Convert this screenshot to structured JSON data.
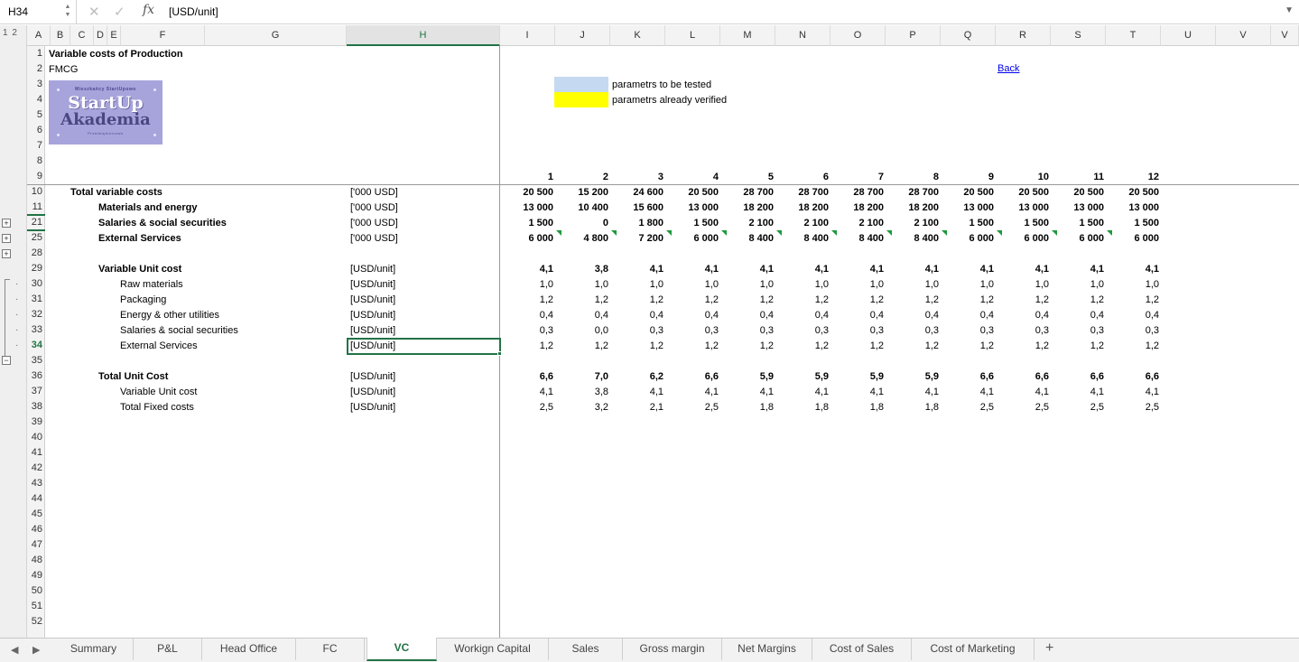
{
  "formula_bar": {
    "name_box": "H34",
    "cancel_icon": "close-icon",
    "confirm_icon": "check-icon",
    "fx_label": "fx",
    "value": "[USD/unit]"
  },
  "outline": {
    "levels": "1 2"
  },
  "columns": [
    "A",
    "B",
    "C",
    "D",
    "E",
    "F",
    "G",
    "H",
    "I",
    "J",
    "K",
    "L",
    "M",
    "N",
    "O",
    "P",
    "Q",
    "R",
    "S",
    "T",
    "U",
    "V",
    "V"
  ],
  "rows": [
    "1",
    "2",
    "3",
    "4",
    "5",
    "6",
    "7",
    "8",
    "9",
    "10",
    "11",
    "21",
    "25",
    "28",
    "29",
    "30",
    "31",
    "32",
    "33",
    "34",
    "35",
    "36",
    "37",
    "38",
    "39",
    "40",
    "41",
    "42",
    "43",
    "44",
    "45",
    "46",
    "47",
    "48",
    "49",
    "50",
    "51",
    "52"
  ],
  "header": {
    "title": "Variable costs of Production",
    "subtitle": "FMCG",
    "back_link": "Back",
    "legend_tested": "parametrs to be tested",
    "legend_verified": "parametrs already verified",
    "logo": {
      "top": "Mieszkańcy StartUpowo",
      "main1": "StartUp",
      "main2": "Akademia",
      "bottom": "Przedsiębiorcowo"
    }
  },
  "months": [
    "1",
    "2",
    "3",
    "4",
    "5",
    "6",
    "7",
    "8",
    "9",
    "10",
    "11",
    "12"
  ],
  "table_rows": [
    {
      "label": "Total variable costs",
      "indent": 0,
      "bold": true,
      "unit": "['000 USD]",
      "values": [
        "20 500",
        "15 200",
        "24 600",
        "20 500",
        "28 700",
        "28 700",
        "28 700",
        "28 700",
        "20 500",
        "20 500",
        "20 500",
        "20 500"
      ]
    },
    {
      "label": "Materials and energy",
      "indent": 1,
      "bold": true,
      "unit": "['000 USD]",
      "values": [
        "13 000",
        "10 400",
        "15 600",
        "13 000",
        "18 200",
        "18 200",
        "18 200",
        "18 200",
        "13 000",
        "13 000",
        "13 000",
        "13 000"
      ]
    },
    {
      "label": "Salaries & social securities",
      "indent": 1,
      "bold": true,
      "unit": "['000 USD]",
      "values": [
        "1 500",
        "0",
        "1 800",
        "1 500",
        "2 100",
        "2 100",
        "2 100",
        "2 100",
        "1 500",
        "1 500",
        "1 500",
        "1 500"
      ]
    },
    {
      "label": "External Services",
      "indent": 1,
      "bold": true,
      "unit": "['000 USD]",
      "values": [
        "6 000",
        "4 800",
        "7 200",
        "6 000",
        "8 400",
        "8 400",
        "8 400",
        "8 400",
        "6 000",
        "6 000",
        "6 000",
        "6 000"
      ]
    },
    {
      "label": "",
      "indent": 0,
      "bold": false,
      "unit": "",
      "values": []
    },
    {
      "label": "Variable Unit cost",
      "indent": 1,
      "bold": true,
      "unit": "[USD/unit]",
      "values": [
        "4,1",
        "3,8",
        "4,1",
        "4,1",
        "4,1",
        "4,1",
        "4,1",
        "4,1",
        "4,1",
        "4,1",
        "4,1",
        "4,1"
      ]
    },
    {
      "label": "Raw materials",
      "indent": 2,
      "bold": false,
      "unit": "[USD/unit]",
      "values": [
        "1,0",
        "1,0",
        "1,0",
        "1,0",
        "1,0",
        "1,0",
        "1,0",
        "1,0",
        "1,0",
        "1,0",
        "1,0",
        "1,0"
      ]
    },
    {
      "label": "Packaging",
      "indent": 2,
      "bold": false,
      "unit": "[USD/unit]",
      "values": [
        "1,2",
        "1,2",
        "1,2",
        "1,2",
        "1,2",
        "1,2",
        "1,2",
        "1,2",
        "1,2",
        "1,2",
        "1,2",
        "1,2"
      ]
    },
    {
      "label": "Energy & other utilities",
      "indent": 2,
      "bold": false,
      "unit": "[USD/unit]",
      "values": [
        "0,4",
        "0,4",
        "0,4",
        "0,4",
        "0,4",
        "0,4",
        "0,4",
        "0,4",
        "0,4",
        "0,4",
        "0,4",
        "0,4"
      ]
    },
    {
      "label": "Salaries & social securities",
      "indent": 2,
      "bold": false,
      "unit": "[USD/unit]",
      "values": [
        "0,3",
        "0,0",
        "0,3",
        "0,3",
        "0,3",
        "0,3",
        "0,3",
        "0,3",
        "0,3",
        "0,3",
        "0,3",
        "0,3"
      ]
    },
    {
      "label": "External Services",
      "indent": 2,
      "bold": false,
      "unit": "[USD/unit]",
      "values": [
        "1,2",
        "1,2",
        "1,2",
        "1,2",
        "1,2",
        "1,2",
        "1,2",
        "1,2",
        "1,2",
        "1,2",
        "1,2",
        "1,2"
      ]
    },
    {
      "label": "",
      "indent": 0,
      "bold": false,
      "unit": "",
      "values": []
    },
    {
      "label": "Total Unit Cost",
      "indent": 1,
      "bold": true,
      "unit": "[USD/unit]",
      "values": [
        "6,6",
        "7,0",
        "6,2",
        "6,6",
        "5,9",
        "5,9",
        "5,9",
        "5,9",
        "6,6",
        "6,6",
        "6,6",
        "6,6"
      ]
    },
    {
      "label": "Variable Unit cost",
      "indent": 2,
      "bold": false,
      "unit": "[USD/unit]",
      "values": [
        "4,1",
        "3,8",
        "4,1",
        "4,1",
        "4,1",
        "4,1",
        "4,1",
        "4,1",
        "4,1",
        "4,1",
        "4,1",
        "4,1"
      ]
    },
    {
      "label": "Total Fixed costs",
      "indent": 2,
      "bold": false,
      "unit": "[USD/unit]",
      "values": [
        "2,5",
        "3,2",
        "2,1",
        "2,5",
        "1,8",
        "1,8",
        "1,8",
        "1,8",
        "2,5",
        "2,5",
        "2,5",
        "2,5"
      ]
    }
  ],
  "sheet_tabs": [
    "Summary",
    "P&L",
    "Head Office",
    "FC",
    "VC",
    "Workign Capital",
    "Sales",
    "Gross margin",
    "Net Margins",
    "Cost of Sales",
    "Cost of Marketing"
  ],
  "active_sheet": "VC",
  "add_sheet": "+",
  "colors": {
    "accent": "#217346",
    "tested": "#c5d9f1",
    "verified": "#ffff00",
    "comment_marker": "#1e9a3c"
  }
}
